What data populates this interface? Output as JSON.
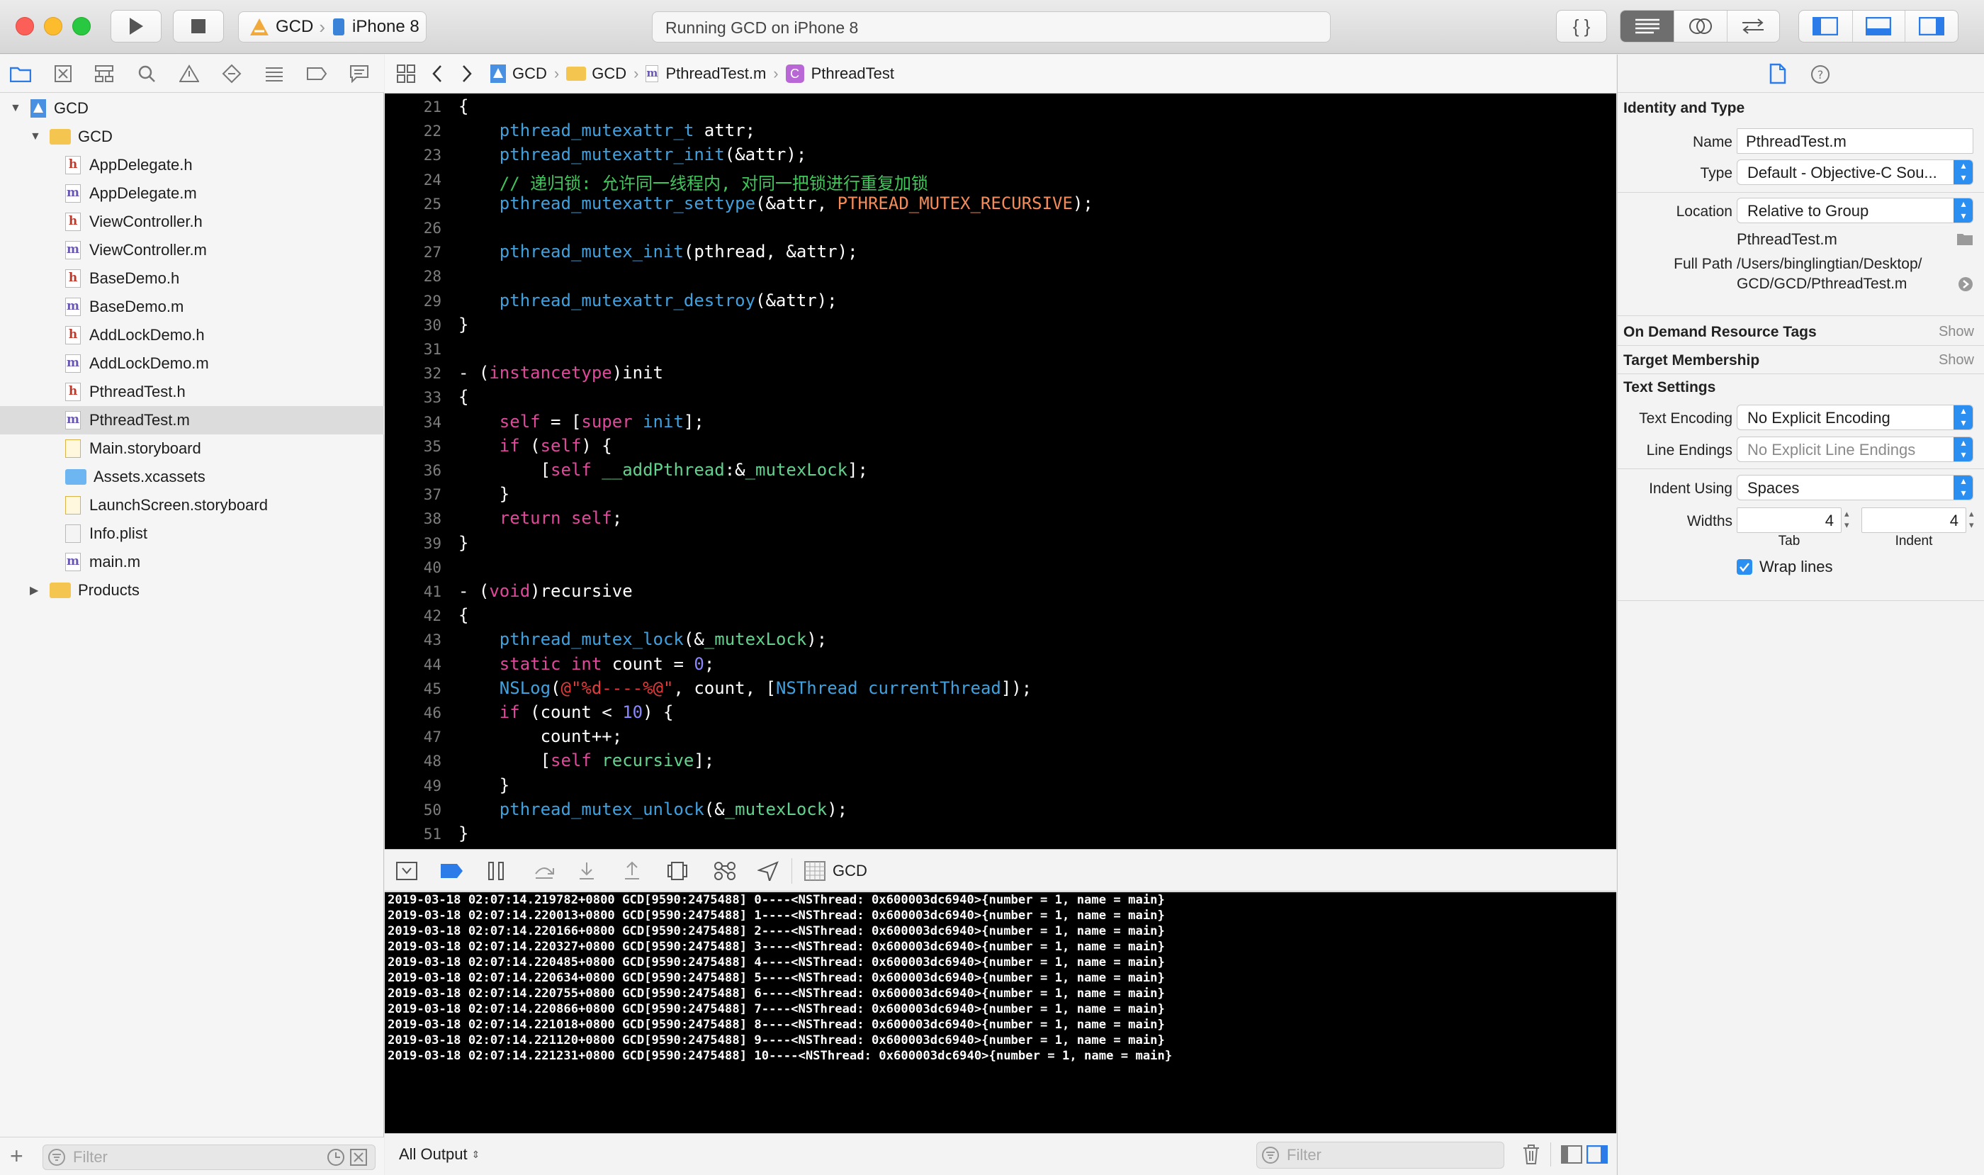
{
  "toolbar": {
    "scheme_target": "GCD",
    "scheme_device": "iPhone 8",
    "activity_status": "Running GCD on iPhone 8"
  },
  "navigator": {
    "items": [
      {
        "label": "GCD",
        "kind": "project"
      },
      {
        "label": "GCD",
        "kind": "folder"
      },
      {
        "label": "AppDelegate.h",
        "kind": "h"
      },
      {
        "label": "AppDelegate.m",
        "kind": "m"
      },
      {
        "label": "ViewController.h",
        "kind": "h"
      },
      {
        "label": "ViewController.m",
        "kind": "m"
      },
      {
        "label": "BaseDemo.h",
        "kind": "h"
      },
      {
        "label": "BaseDemo.m",
        "kind": "m"
      },
      {
        "label": "AddLockDemo.h",
        "kind": "h"
      },
      {
        "label": "AddLockDemo.m",
        "kind": "m"
      },
      {
        "label": "PthreadTest.h",
        "kind": "h"
      },
      {
        "label": "PthreadTest.m",
        "kind": "m"
      },
      {
        "label": "Main.storyboard",
        "kind": "storyboard"
      },
      {
        "label": "Assets.xcassets",
        "kind": "assets"
      },
      {
        "label": "LaunchScreen.storyboard",
        "kind": "storyboard"
      },
      {
        "label": "Info.plist",
        "kind": "plist"
      },
      {
        "label": "main.m",
        "kind": "m"
      },
      {
        "label": "Products",
        "kind": "folder"
      }
    ],
    "filter_placeholder": "Filter"
  },
  "jumpbar": {
    "crumb1": "GCD",
    "crumb2": "GCD",
    "crumb3": "PthreadTest.m",
    "crumb4": "PthreadTest"
  },
  "editor": {
    "lines": [
      {
        "n": "21",
        "html": "{"
      },
      {
        "n": "22",
        "html": "    <span class='fn'>pthread_mutexattr_t</span> attr;"
      },
      {
        "n": "23",
        "html": "    <span class='fn'>pthread_mutexattr_init</span>(&amp;attr);"
      },
      {
        "n": "24",
        "html": "    <span class='cm'>// 递归锁: 允许同一线程内, 对同一把锁进行重复加锁</span>"
      },
      {
        "n": "25",
        "html": "    <span class='fn'>pthread_mutexattr_settype</span>(&amp;attr, <span class='mac'>PTHREAD_MUTEX_RECURSIVE</span>);"
      },
      {
        "n": "26",
        "html": ""
      },
      {
        "n": "27",
        "html": "    <span class='fn'>pthread_mutex_init</span>(pthread, &amp;attr);"
      },
      {
        "n": "28",
        "html": ""
      },
      {
        "n": "29",
        "html": "    <span class='fn'>pthread_mutexattr_destroy</span>(&amp;attr);"
      },
      {
        "n": "30",
        "html": "}"
      },
      {
        "n": "31",
        "html": ""
      },
      {
        "n": "32",
        "html": "- (<span class='kw'>instancetype</span>)init"
      },
      {
        "n": "33",
        "html": "{"
      },
      {
        "n": "34",
        "html": "    <span class='kw'>self</span> = [<span class='kw'>super</span> <span class='fn'>init</span>];"
      },
      {
        "n": "35",
        "html": "    <span class='kw'>if</span> (<span class='kw'>self</span>) {"
      },
      {
        "n": "36",
        "html": "        [<span class='kw'>self</span> <span class='var'>__addPthread</span>:&amp;<span class='var'>_mutexLock</span>];"
      },
      {
        "n": "37",
        "html": "    }"
      },
      {
        "n": "38",
        "html": "    <span class='kw'>return</span> <span class='kw'>self</span>;"
      },
      {
        "n": "39",
        "html": "}"
      },
      {
        "n": "40",
        "html": ""
      },
      {
        "n": "41",
        "html": "- (<span class='kw'>void</span>)recursive"
      },
      {
        "n": "42",
        "html": "{"
      },
      {
        "n": "43",
        "html": "    <span class='fn'>pthread_mutex_lock</span>(&amp;<span class='var'>_mutexLock</span>);"
      },
      {
        "n": "44",
        "html": "    <span class='kw'>static</span> <span class='kw'>int</span> count = <span class='num'>0</span>;"
      },
      {
        "n": "45",
        "html": "    <span class='fn'>NSLog</span>(<span class='str'>@\"%d----%@\"</span>, count, [<span class='fn'>NSThread</span> <span class='fn'>currentThread</span>]);"
      },
      {
        "n": "46",
        "html": "    <span class='kw'>if</span> (count &lt; <span class='num'>10</span>) {"
      },
      {
        "n": "47",
        "html": "        count++;"
      },
      {
        "n": "48",
        "html": "        [<span class='kw'>self</span> <span class='var'>recursive</span>];"
      },
      {
        "n": "49",
        "html": "    }"
      },
      {
        "n": "50",
        "html": "    <span class='fn'>pthread_mutex_unlock</span>(&amp;<span class='var'>_mutexLock</span>);"
      },
      {
        "n": "51",
        "html": "}"
      }
    ]
  },
  "debug": {
    "target_label": "GCD",
    "output_selector": "All Output",
    "filter_placeholder": "Filter",
    "console_lines": [
      "2019-03-18 02:07:14.219782+0800 GCD[9590:2475488] 0----<NSThread: 0x600003dc6940>{number = 1, name = main}",
      "2019-03-18 02:07:14.220013+0800 GCD[9590:2475488] 1----<NSThread: 0x600003dc6940>{number = 1, name = main}",
      "2019-03-18 02:07:14.220166+0800 GCD[9590:2475488] 2----<NSThread: 0x600003dc6940>{number = 1, name = main}",
      "2019-03-18 02:07:14.220327+0800 GCD[9590:2475488] 3----<NSThread: 0x600003dc6940>{number = 1, name = main}",
      "2019-03-18 02:07:14.220485+0800 GCD[9590:2475488] 4----<NSThread: 0x600003dc6940>{number = 1, name = main}",
      "2019-03-18 02:07:14.220634+0800 GCD[9590:2475488] 5----<NSThread: 0x600003dc6940>{number = 1, name = main}",
      "2019-03-18 02:07:14.220755+0800 GCD[9590:2475488] 6----<NSThread: 0x600003dc6940>{number = 1, name = main}",
      "2019-03-18 02:07:14.220866+0800 GCD[9590:2475488] 7----<NSThread: 0x600003dc6940>{number = 1, name = main}",
      "2019-03-18 02:07:14.221018+0800 GCD[9590:2475488] 8----<NSThread: 0x600003dc6940>{number = 1, name = main}",
      "2019-03-18 02:07:14.221120+0800 GCD[9590:2475488] 9----<NSThread: 0x600003dc6940>{number = 1, name = main}",
      "2019-03-18 02:07:14.221231+0800 GCD[9590:2475488] 10----<NSThread: 0x600003dc6940>{number = 1, name = main}"
    ]
  },
  "inspector": {
    "identity_heading": "Identity and Type",
    "name_label": "Name",
    "name_value": "PthreadTest.m",
    "type_label": "Type",
    "type_value": "Default - Objective-C Sou...",
    "location_label": "Location",
    "location_value": "Relative to Group",
    "location_file": "PthreadTest.m",
    "fullpath_label": "Full Path",
    "fullpath_line1": "/Users/binglingtian/Desktop/",
    "fullpath_line2": "GCD/GCD/PthreadTest.m",
    "odr_heading": "On Demand Resource Tags",
    "odr_show": "Show",
    "target_heading": "Target Membership",
    "target_show": "Show",
    "text_heading": "Text Settings",
    "encoding_label": "Text Encoding",
    "encoding_value": "No Explicit Encoding",
    "endings_label": "Line Endings",
    "endings_value": "No Explicit Line Endings",
    "indent_label": "Indent Using",
    "indent_value": "Spaces",
    "widths_label": "Widths",
    "tab_value": "4",
    "indent_width_value": "4",
    "tab_caption": "Tab",
    "indent_caption": "Indent",
    "wrap_label": "Wrap lines"
  }
}
